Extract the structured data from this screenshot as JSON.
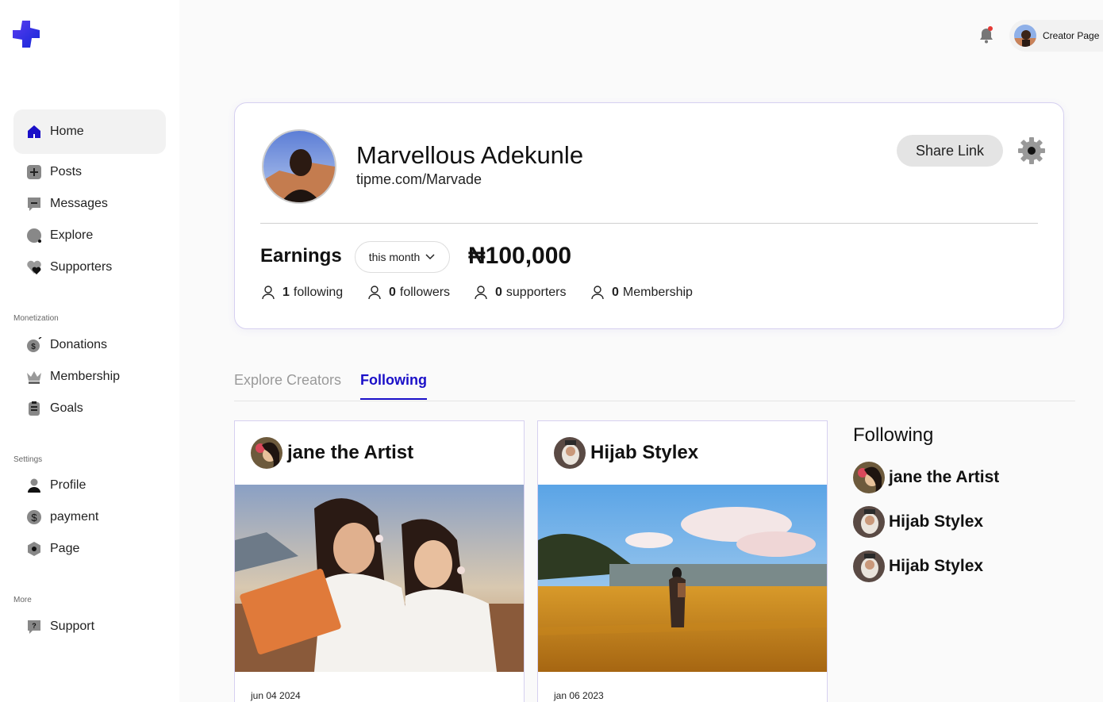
{
  "nav": {
    "items": [
      {
        "label": "Home",
        "icon": "home-icon"
      },
      {
        "label": "Posts",
        "icon": "plus-square-icon"
      },
      {
        "label": "Messages",
        "icon": "message-icon"
      },
      {
        "label": "Explore",
        "icon": "compass-icon"
      },
      {
        "label": "Supporters",
        "icon": "heart-icon"
      }
    ],
    "sections": {
      "monetization": "Monetization",
      "settings": "Settings",
      "more": "More"
    },
    "monetization_items": [
      {
        "label": "Donations",
        "icon": "dollar-bag-icon"
      },
      {
        "label": "Membership",
        "icon": "crown-icon"
      },
      {
        "label": "Goals",
        "icon": "clipboard-icon"
      }
    ],
    "settings_items": [
      {
        "label": "Profile",
        "icon": "user-icon"
      },
      {
        "label": "payment",
        "icon": "dollar-circle-icon"
      },
      {
        "label": "Page",
        "icon": "hexagon-icon"
      }
    ],
    "more_items": [
      {
        "label": "Support",
        "icon": "help-message-icon"
      }
    ]
  },
  "topbar": {
    "creator_page_label": "Creator Page"
  },
  "profile": {
    "name": "Marvellous Adekunle",
    "link": "tipme.com/Marvade",
    "share_label": "Share Link",
    "earnings_label": "Earnings",
    "period": "this month",
    "earnings_value": "₦100,000",
    "stats": [
      {
        "count": "1",
        "label": "following"
      },
      {
        "count": "0",
        "label": "followers"
      },
      {
        "count": "0",
        "label": "supporters"
      },
      {
        "count": "0",
        "label": "Membership"
      }
    ]
  },
  "tabs": {
    "explore": "Explore Creators",
    "following": "Following"
  },
  "posts": [
    {
      "author": "jane the Artist",
      "date": "jun 04 2024"
    },
    {
      "author": "Hijab Stylex",
      "date": "jan 06 2023"
    }
  ],
  "following": {
    "title": "Following",
    "items": [
      {
        "name": "jane the Artist"
      },
      {
        "name": "Hijab Stylex"
      },
      {
        "name": "Hijab Stylex"
      }
    ]
  },
  "colors": {
    "accent": "#1a0fc8",
    "card_border": "#d6d0f0",
    "notification_dot": "#e53935"
  }
}
